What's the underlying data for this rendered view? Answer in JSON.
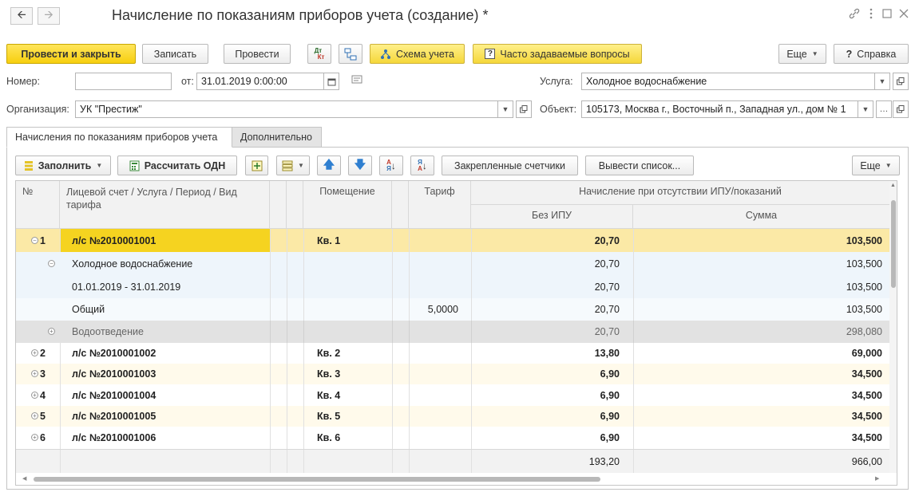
{
  "window": {
    "title": "Начисление по показаниям приборов учета (создание) *",
    "back_icon": "arrow-left-icon",
    "forward_icon": "arrow-right-icon"
  },
  "toolbar": {
    "post_close": "Провести и закрыть",
    "save": "Записать",
    "post": "Провести",
    "account_scheme": "Схема учета",
    "faq": "Часто задаваемые вопросы",
    "more": "Еще",
    "help": "Справка",
    "dt_kt_icon_top": "Дт",
    "dt_kt_icon_bottom": "Кт"
  },
  "form": {
    "number_label": "Номер:",
    "number_value": "",
    "date_label": "от:",
    "date_value": "31.01.2019  0:00:00",
    "org_label": "Организация:",
    "org_value": "УК \"Престиж\"",
    "service_label": "Услуга:",
    "service_value": "Холодное водоснабжение",
    "object_label": "Объект:",
    "object_value": "105173, Москва г., Восточный п., Западная ул., дом № 1"
  },
  "tabs": [
    {
      "label": "Начисления по показаниям приборов учета",
      "active": true
    },
    {
      "label": "Дополнительно",
      "active": false
    }
  ],
  "grid_toolbar": {
    "fill": "Заполнить",
    "calc_odn": "Рассчитать ОДН",
    "pinned_meters": "Закрепленные счетчики",
    "print_list": "Вывести список...",
    "more": "Еще",
    "sort_asc_top": "А",
    "sort_asc_bottom": "Я",
    "sort_desc_top": "Я",
    "sort_desc_bottom": "А"
  },
  "columns": {
    "num": "№",
    "account": "Лицевой счет / Услуга / Период / Вид тарифа",
    "premises": "Помещение",
    "tariff": "Тариф",
    "group": "Начисление при отсутствии ИПУ/показаний",
    "no_ipu": "Без ИПУ",
    "sum": "Сумма"
  },
  "rows": [
    {
      "num": "1",
      "account": "л/с №2010001001",
      "premises": "Кв. 1",
      "tariff": "",
      "no_ipu": "20,70",
      "sum": "103,500",
      "level": 0,
      "style": "selected",
      "tree": "−"
    },
    {
      "num": "",
      "account": "Холодное водоснабжение",
      "premises": "",
      "tariff": "",
      "no_ipu": "20,70",
      "sum": "103,500",
      "level": 1,
      "style": "child",
      "tree": "−"
    },
    {
      "num": "",
      "account": "01.01.2019 - 31.01.2019",
      "premises": "",
      "tariff": "",
      "no_ipu": "20,70",
      "sum": "103,500",
      "level": 2,
      "style": "child",
      "tree": ""
    },
    {
      "num": "",
      "account": "Общий",
      "premises": "",
      "tariff": "5,0000",
      "no_ipu": "20,70",
      "sum": "103,500",
      "level": 2,
      "style": "child2",
      "tree": ""
    },
    {
      "num": "",
      "account": "Водоотведение",
      "premises": "",
      "tariff": "",
      "no_ipu": "20,70",
      "sum": "298,080",
      "level": 1,
      "style": "grey",
      "tree": "+"
    },
    {
      "num": "2",
      "account": "л/с №2010001002",
      "premises": "Кв. 2",
      "tariff": "",
      "no_ipu": "13,80",
      "sum": "69,000",
      "level": 0,
      "style": "white",
      "tree": "+"
    },
    {
      "num": "3",
      "account": "л/с №2010001003",
      "premises": "Кв. 3",
      "tariff": "",
      "no_ipu": "6,90",
      "sum": "34,500",
      "level": 0,
      "style": "cream",
      "tree": "+"
    },
    {
      "num": "4",
      "account": "л/с №2010001004",
      "premises": "Кв. 4",
      "tariff": "",
      "no_ipu": "6,90",
      "sum": "34,500",
      "level": 0,
      "style": "white",
      "tree": "+"
    },
    {
      "num": "5",
      "account": "л/с №2010001005",
      "premises": "Кв. 5",
      "tariff": "",
      "no_ipu": "6,90",
      "sum": "34,500",
      "level": 0,
      "style": "cream",
      "tree": "+"
    },
    {
      "num": "6",
      "account": "л/с №2010001006",
      "premises": "Кв. 6",
      "tariff": "",
      "no_ipu": "6,90",
      "sum": "34,500",
      "level": 0,
      "style": "white",
      "tree": "+"
    }
  ],
  "totals": {
    "no_ipu": "193,20",
    "sum": "966,00"
  },
  "colors": {
    "yellow": "#f7cf0f",
    "selected_row": "#fbe9a6",
    "selected_cell": "#f5d320",
    "child_row": "#eef5fb",
    "cream_row": "#fffaeb",
    "grey_row": "#e2e2e2"
  }
}
